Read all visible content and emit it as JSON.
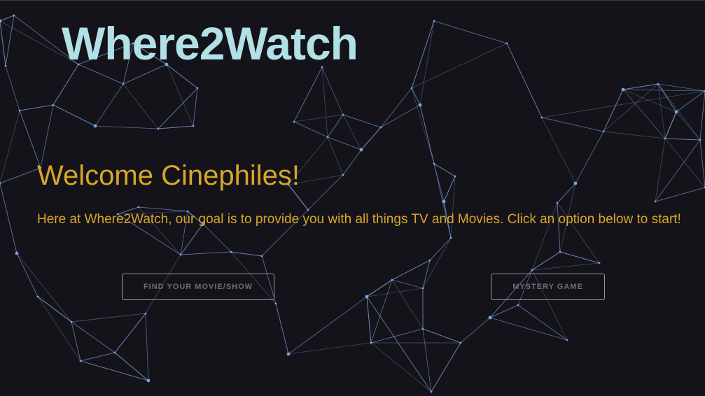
{
  "colors": {
    "background": "#141319",
    "brand": "#b1e0e6",
    "accent": "#d9a62b",
    "network_line": "#6f8fc4",
    "network_node": "#7fb0ef",
    "button_border": "#9a9aa0",
    "button_text": "#6e6e74"
  },
  "header": {
    "brand": "Where2Watch"
  },
  "hero": {
    "title": "Welcome Cinephiles!",
    "intro": "Here at Where2Watch, our goal is to provide you with all things TV and Movies. Click an option below to start!"
  },
  "actions": {
    "find_label": "FIND YOUR MOVIE/SHOW",
    "mystery_label": "MYSTERY GAME"
  }
}
